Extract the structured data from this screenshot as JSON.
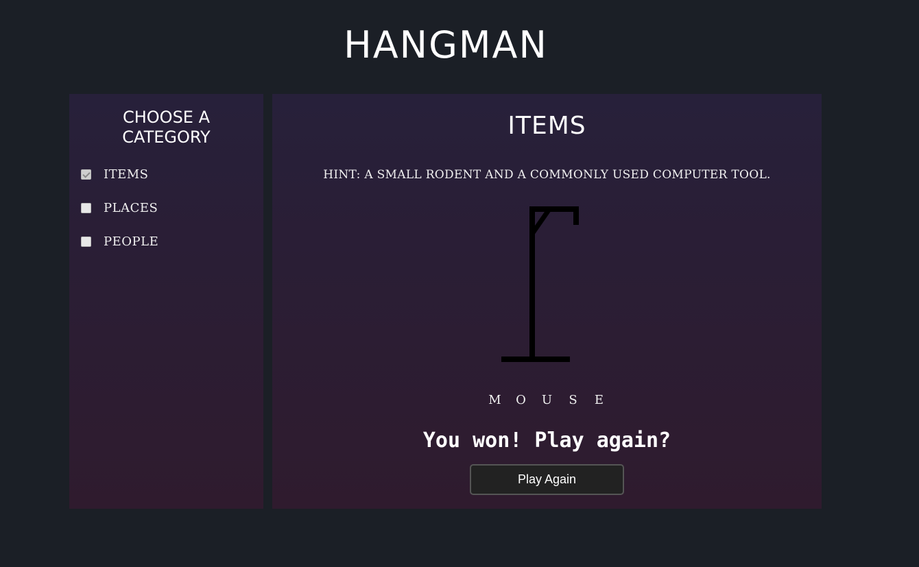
{
  "app": {
    "title": "HANGMAN"
  },
  "sidebar": {
    "heading_line1": "CHOOSE A",
    "heading_line2": "CATEGORY",
    "categories": [
      {
        "label": "ITEMS",
        "checked": true
      },
      {
        "label": "PLACES",
        "checked": false
      },
      {
        "label": "PEOPLE",
        "checked": false
      }
    ]
  },
  "game": {
    "category": "ITEMS",
    "hint": "HINT: A SMALL RODENT AND A COMMONLY USED COMPUTER TOOL.",
    "word_letters": [
      "M",
      "O",
      "U",
      "S",
      "E"
    ],
    "result_message": "You won! Play again?",
    "play_again_label": "Play Again",
    "incorrect_guesses": 0
  },
  "colors": {
    "background": "#1b1f26",
    "panel_top": "#27203a",
    "panel_bottom": "#2f1b2e",
    "gallows": "#000000",
    "button_bg": "#222222"
  }
}
